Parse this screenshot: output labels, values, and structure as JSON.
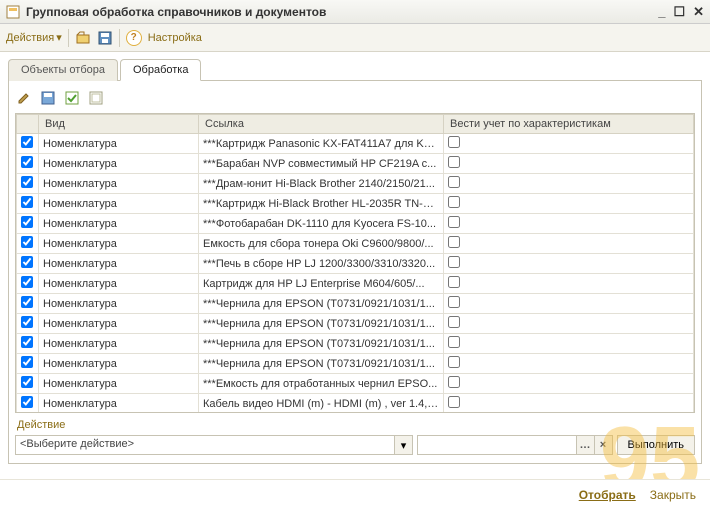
{
  "window": {
    "title": "Групповая обработка справочников и документов"
  },
  "toolbar": {
    "actions_label": "Действия",
    "settings_label": "Настройка"
  },
  "tabs": {
    "tab1": "Объекты отбора",
    "tab2": "Обработка",
    "active": 1
  },
  "grid": {
    "headers": {
      "type": "Вид",
      "link": "Ссылка",
      "char": "Вести учет по характеристикам"
    },
    "rows": [
      {
        "checked": true,
        "type": "Номенклатура",
        "link": "***Картридж Panasonic KX-FAT411A7 для KX-..."
      },
      {
        "checked": true,
        "type": "Номенклатура",
        "link": "***Барабан NVP совместимый HP CF219A с..."
      },
      {
        "checked": true,
        "type": "Номенклатура",
        "link": "***Драм-юнит Hi-Black Brother 2140/2150/21..."
      },
      {
        "checked": true,
        "type": "Номенклатура",
        "link": "***Картридж Hi-Black Brother HL-2035R TN-20..."
      },
      {
        "checked": true,
        "type": "Номенклатура",
        "link": "***Фотобарабан DK-1110 для Kyocera  FS-10..."
      },
      {
        "checked": true,
        "type": "Номенклатура",
        "link": "Емкость для сбора тонера Oki C9600/9800/..."
      },
      {
        "checked": true,
        "type": "Номенклатура",
        "link": "***Печь в сборе HP LJ 1200/3300/3310/3320..."
      },
      {
        "checked": true,
        "type": "Номенклатура",
        "link": "Картридж для HP LJ Enterprise M604/605/..."
      },
      {
        "checked": true,
        "type": "Номенклатура",
        "link": "***Чернила для EPSON (T0731/0921/1031/1..."
      },
      {
        "checked": true,
        "type": "Номенклатура",
        "link": "***Чернила для EPSON (T0731/0921/1031/1..."
      },
      {
        "checked": true,
        "type": "Номенклатура",
        "link": "***Чернила для EPSON (T0731/0921/1031/1..."
      },
      {
        "checked": true,
        "type": "Номенклатура",
        "link": "***Чернила для EPSON (T0731/0921/1031/1..."
      },
      {
        "checked": true,
        "type": "Номенклатура",
        "link": "***Емкость для отработанных чернил EPSO..."
      },
      {
        "checked": true,
        "type": "Номенклатура",
        "link": "Кабель видео HDMI (m) - HDMI (m) , ver 1.4, 1..."
      }
    ]
  },
  "action": {
    "label": "Действие",
    "placeholder": "<Выберите действие>",
    "execute": "Выполнить"
  },
  "footer": {
    "select": "Отобрать",
    "close": "Закрыть"
  },
  "watermark": "95"
}
